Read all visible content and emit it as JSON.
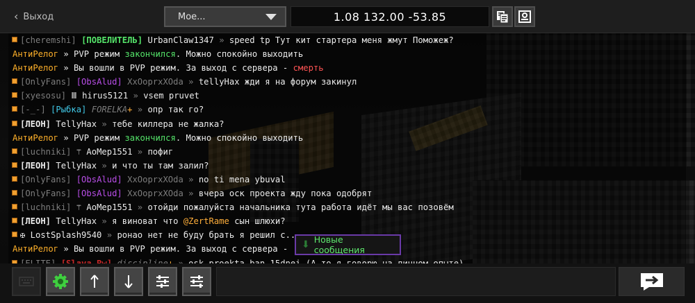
{
  "topbar": {
    "back_label": "Выход",
    "dropdown_value": "Мое...",
    "coords": "1.08 132.00 -53.85"
  },
  "chat": [
    {
      "segs": [
        [
          "[cheremshi] ",
          "gray"
        ],
        [
          "[ПОВЕЛИТЕЛЬ]",
          "green-bold"
        ],
        [
          " UrbanClaw1347 ",
          "white"
        ],
        [
          "» ",
          "gray"
        ],
        [
          "speed tp Тут кит стартера меня жмут Поможеж?",
          "white"
        ]
      ],
      "bullet": true
    },
    {
      "segs": [
        [
          "АнтиРелог",
          "yellow"
        ],
        [
          " » PVP режим ",
          "white"
        ],
        [
          "закончился",
          "green"
        ],
        [
          ". Можно спокойно выходить",
          "white"
        ]
      ],
      "bullet": false
    },
    {
      "segs": [
        [
          "АнтиРелог",
          "yellow"
        ],
        [
          " » Вы вошли в PVP режим. За выход с сервера - ",
          "white"
        ],
        [
          "смерть",
          "red"
        ]
      ],
      "bullet": false
    },
    {
      "segs": [
        [
          "[OnlyFans] ",
          "gray"
        ],
        [
          "[ObsAlud]",
          "purple"
        ],
        [
          " XxOoprxXOda ",
          "gray"
        ],
        [
          "» ",
          "gray"
        ],
        [
          " tellyHax жди я на форум закинул",
          "white"
        ]
      ],
      "bullet": true
    },
    {
      "segs": [
        [
          "[xyesosu] ",
          "gray"
        ],
        [
          "Ⅲ hirus5121 ",
          "white"
        ],
        [
          "» ",
          "gray"
        ],
        [
          " vsem pruvet",
          "white"
        ]
      ],
      "bullet": true
    },
    {
      "segs": [
        [
          "[-_-] ",
          "gray"
        ],
        [
          "[Рыбка]",
          "cyan"
        ],
        [
          " FORELKA",
          "gray-ital"
        ],
        [
          "+",
          "orange"
        ],
        [
          " » ",
          "gray"
        ],
        [
          "опр так го?",
          "white"
        ]
      ],
      "bullet": true
    },
    {
      "segs": [
        [
          "[ЛЕОН]",
          "white-bold"
        ],
        [
          " TellyHax ",
          "white"
        ],
        [
          "» ",
          "gray"
        ],
        [
          " тебе киллера не жалка?",
          "white"
        ]
      ],
      "bullet": true
    },
    {
      "segs": [
        [
          "АнтиРелог",
          "yellow"
        ],
        [
          " » PVP режим ",
          "white"
        ],
        [
          "закончился",
          "green"
        ],
        [
          ". Можно спокойно выходить",
          "white"
        ]
      ],
      "bullet": false
    },
    {
      "segs": [
        [
          "[luchniki] ",
          "gray"
        ],
        [
          "⚚ AoMep1551 ",
          "white"
        ],
        [
          "» ",
          "gray"
        ],
        [
          "пофиг",
          "white"
        ]
      ],
      "bullet": true
    },
    {
      "segs": [
        [
          "[ЛЕОН]",
          "white-bold"
        ],
        [
          " TellyHax ",
          "white"
        ],
        [
          "» ",
          "gray"
        ],
        [
          " и что ты там залил?",
          "white"
        ]
      ],
      "bullet": true
    },
    {
      "segs": [
        [
          "[OnlyFans] ",
          "gray"
        ],
        [
          "[ObsAlud]",
          "purple"
        ],
        [
          " XxOoprxXOda ",
          "gray"
        ],
        [
          "» ",
          "gray"
        ],
        [
          "no ti mena ybuval",
          "white"
        ]
      ],
      "bullet": true
    },
    {
      "segs": [
        [
          "[OnlyFans] ",
          "gray"
        ],
        [
          "[ObsAlud]",
          "purple"
        ],
        [
          " XxOoprxXOda ",
          "gray"
        ],
        [
          "» ",
          "gray"
        ],
        [
          " вчера оск проекта жду пока одобрят",
          "white"
        ]
      ],
      "bullet": true
    },
    {
      "segs": [
        [
          "[luchniki] ",
          "gray"
        ],
        [
          "⚚ AoMep1551 ",
          "white"
        ],
        [
          "» ",
          "gray"
        ],
        [
          "отойди пожалуйста начальника тута работа идёт мы вас позовём",
          "white"
        ]
      ],
      "bullet": true
    },
    {
      "segs": [
        [
          "[ЛЕОН]",
          "white-bold"
        ],
        [
          " TellyHax ",
          "white"
        ],
        [
          "» ",
          "gray"
        ],
        [
          " я виноват что ",
          "white"
        ],
        [
          "@ZertRame",
          "orange"
        ],
        [
          " сын шлюхи?",
          "white"
        ]
      ],
      "bullet": true
    },
    {
      "segs": [
        [
          "✠ LostSplash9540 ",
          "white"
        ],
        [
          "» ",
          "gray"
        ],
        [
          " ронао нет не буду брать я решил с...",
          "white"
        ]
      ],
      "bullet": true
    },
    {
      "segs": [
        [
          "АнтиРелог",
          "yellow"
        ],
        [
          " » Вы вошли в PVP режим. За выход с сервера - ",
          "white"
        ]
      ],
      "bullet": false
    },
    {
      "segs": [
        [
          "[ELITE] ",
          "gray"
        ],
        [
          "[Slava_Rw]",
          "darkred"
        ],
        [
          " discipline",
          "gray-ital"
        ],
        [
          "+",
          "orange"
        ],
        [
          " » ",
          "gray"
        ],
        [
          "osk proekta ban 15dnei (А то я говорю на личном опыте)",
          "white"
        ]
      ],
      "bullet": true
    }
  ],
  "toast": {
    "label": "Новые сообщения"
  },
  "bottom": {
    "input_value": "",
    "buttons": [
      "keyboard-icon",
      "settings-gear-icon",
      "scroll-up-icon",
      "scroll-down-icon",
      "filter-tune-icon",
      "filter-alt-icon"
    ]
  },
  "colors": {
    "bullet": "#f0a030",
    "accent_green": "#55e56a",
    "toast_border": "#6a3aa8"
  }
}
